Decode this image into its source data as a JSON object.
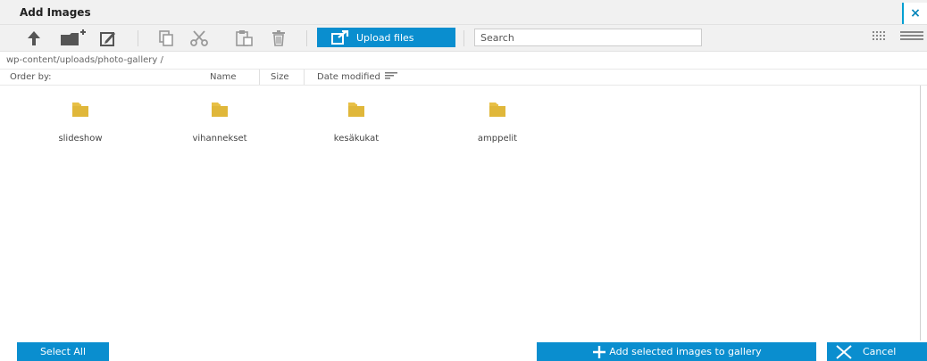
{
  "dialog": {
    "title": "Add Images",
    "close_symbol": "×"
  },
  "toolbar": {
    "icons": [
      "arrow-up-icon",
      "new-folder-icon",
      "edit-icon",
      "copy-icon",
      "cut-icon",
      "paste-icon",
      "trash-icon"
    ],
    "upload_label": "Upload files",
    "upload_icon": "external-upload-icon",
    "search_placeholder": "Search",
    "view_icons": [
      "thumbnail-view-icon",
      "list-view-icon"
    ]
  },
  "path": "wp-content/uploads/photo-gallery /",
  "order": {
    "label": "Order by:",
    "name": "Name",
    "size": "Size",
    "date": "Date modified"
  },
  "folders": [
    {
      "name": "slideshow"
    },
    {
      "name": "vihannekset"
    },
    {
      "name": "kesäkukat"
    },
    {
      "name": "amppelit"
    }
  ],
  "footer": {
    "select_all": "Select All",
    "add_selected": "Add selected images to gallery",
    "cancel": "Cancel"
  },
  "colors": {
    "accent": "#0a8ecf",
    "folder": "#e8c046",
    "toolbar_bg": "#f1f1f1"
  }
}
